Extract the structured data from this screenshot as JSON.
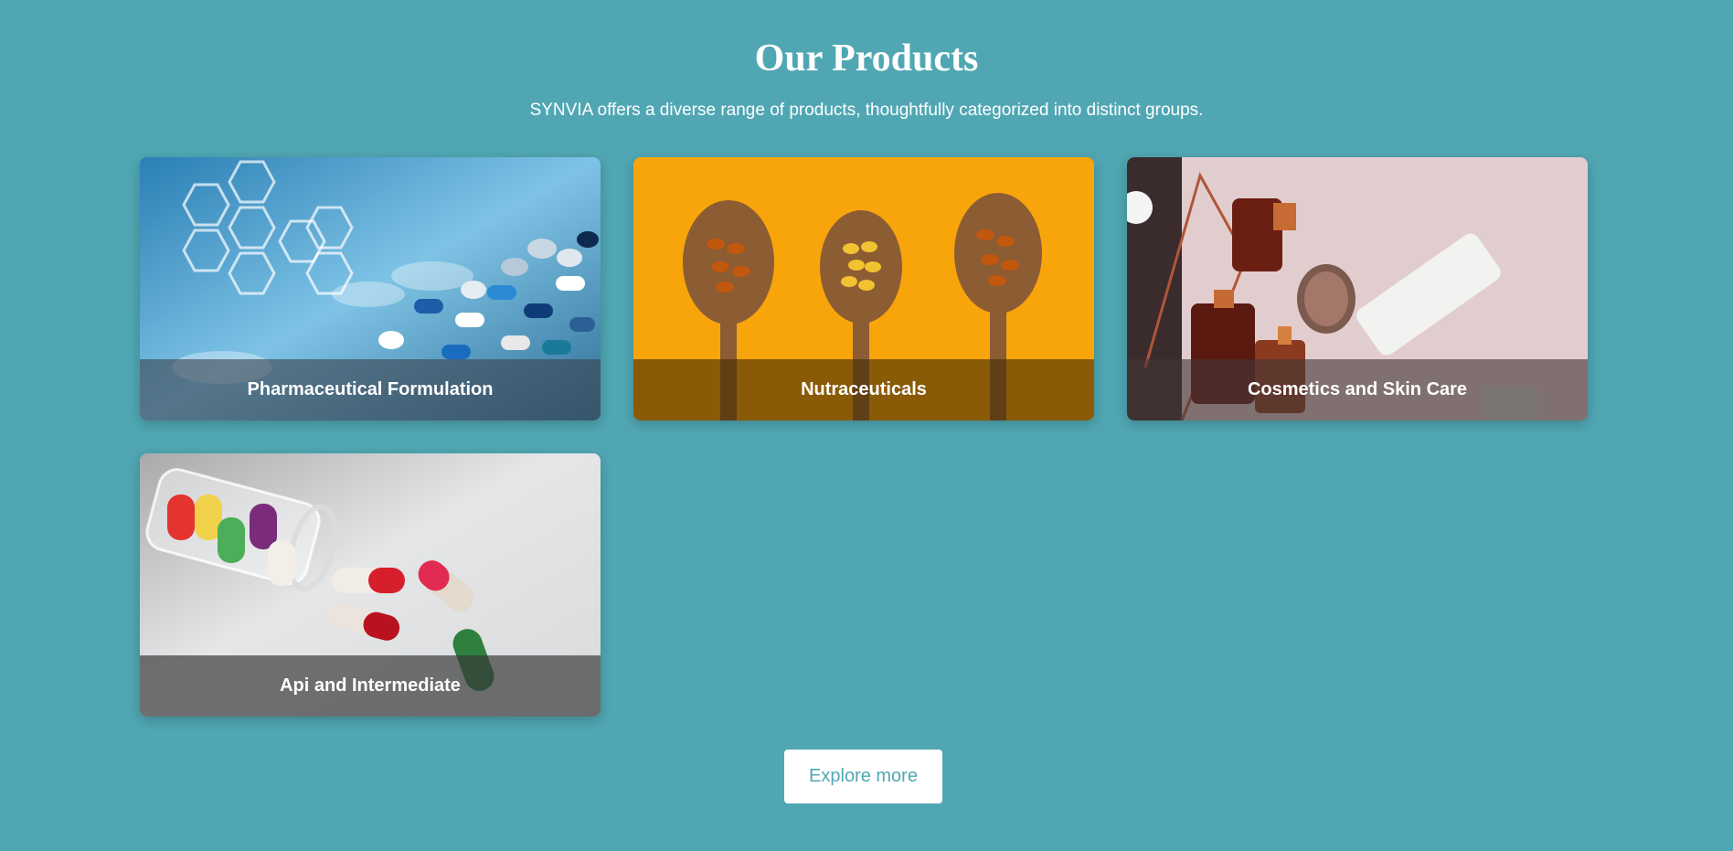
{
  "section": {
    "title": "Our Products",
    "subtitle": "SYNVIA offers a diverse range of products, thoughtfully categorized into distinct groups."
  },
  "products": [
    {
      "label": "Pharmaceutical Formulation",
      "image": "pills-and-lab-glassware-photo"
    },
    {
      "label": "Nutraceuticals",
      "image": "capsules-on-wooden-spoons-photo"
    },
    {
      "label": "Cosmetics and Skin Care",
      "image": "cosmetic-bottles-photo"
    },
    {
      "label": "Api and Intermediate",
      "image": "spilled-capsules-jar-photo"
    }
  ],
  "cta": {
    "label": "Explore more"
  },
  "colors": {
    "background": "#50a7b3",
    "button_bg": "#ffffff",
    "button_text": "#50a7b3"
  }
}
